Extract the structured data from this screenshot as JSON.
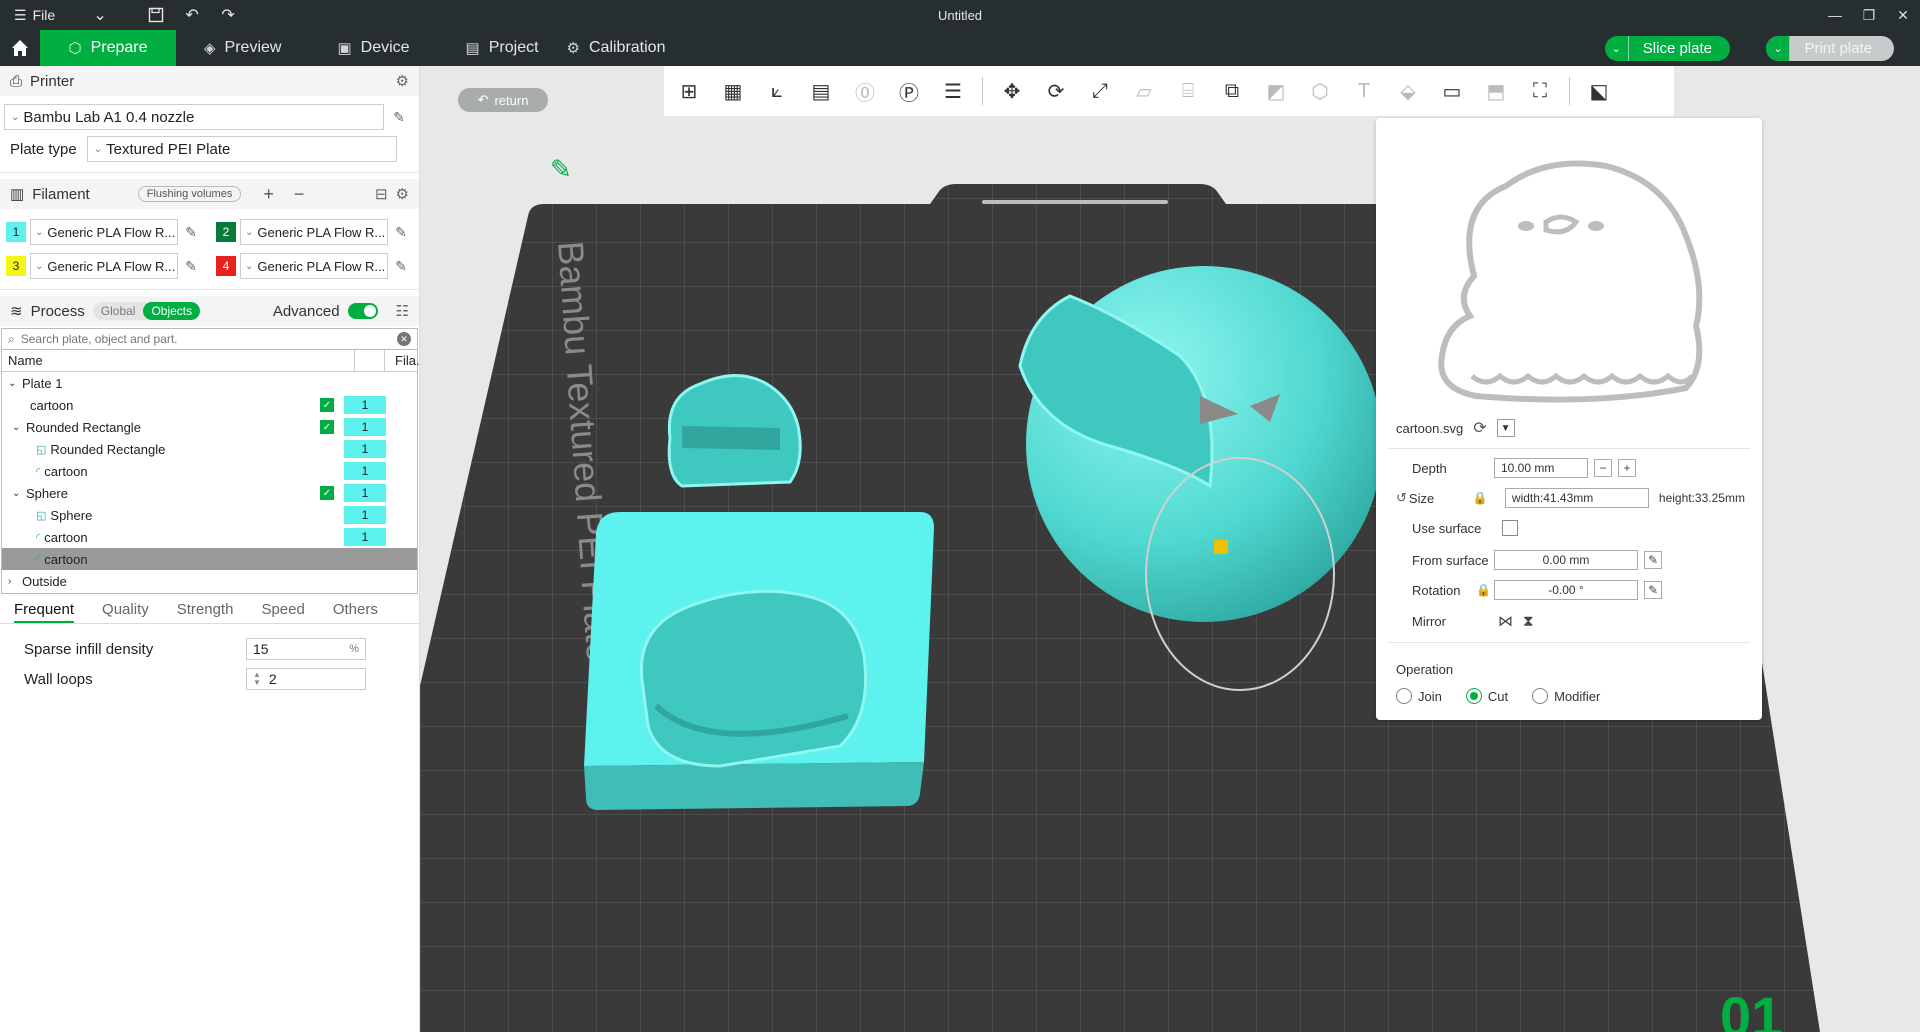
{
  "titlebar": {
    "file_label": "File",
    "window_title": "Untitled"
  },
  "tabs": {
    "prepare": "Prepare",
    "preview": "Preview",
    "device": "Device",
    "project": "Project",
    "calibration": "Calibration"
  },
  "actions": {
    "slice": "Slice plate",
    "print": "Print plate"
  },
  "printer": {
    "section": "Printer",
    "name": "Bambu Lab A1 0.4 nozzle",
    "plate_type_label": "Plate type",
    "plate_type": "Textured PEI Plate"
  },
  "filament": {
    "section": "Filament",
    "flushing": "Flushing volumes",
    "items": [
      {
        "num": "1",
        "color": "#5ef2ee",
        "name": "Generic PLA Flow R..."
      },
      {
        "num": "2",
        "color": "#0a7a3a",
        "name": "Generic PLA Flow R..."
      },
      {
        "num": "3",
        "color": "#f5f51a",
        "name": "Generic PLA Flow R..."
      },
      {
        "num": "4",
        "color": "#e8231f",
        "name": "Generic PLA Flow R..."
      }
    ]
  },
  "process": {
    "section": "Process",
    "global": "Global",
    "objects": "Objects",
    "advanced": "Advanced",
    "search_placeholder": "Search plate, object and part."
  },
  "tree": {
    "col_name": "Name",
    "col_fila": "Fila.",
    "plate": "Plate 1",
    "rows": [
      {
        "name": "cartoon",
        "fila": "1"
      },
      {
        "name": "Rounded Rectangle",
        "fila": "1"
      },
      {
        "name": "Rounded Rectangle",
        "fila": "1"
      },
      {
        "name": "cartoon",
        "fila": "1"
      },
      {
        "name": "Sphere",
        "fila": "1"
      },
      {
        "name": "Sphere",
        "fila": "1"
      },
      {
        "name": "cartoon",
        "fila": "1"
      },
      {
        "name": "cartoon",
        "fila": ""
      }
    ],
    "outside": "Outside"
  },
  "settings": {
    "tabs": [
      "Frequent",
      "Quality",
      "Strength",
      "Speed",
      "Others"
    ],
    "sparse_label": "Sparse infill density",
    "sparse_value": "15",
    "sparse_unit": "%",
    "wall_label": "Wall loops",
    "wall_value": "2"
  },
  "viewport": {
    "return_label": "return",
    "plate_text": "Bambu Textured PEI Plate",
    "plate_number": "01"
  },
  "svg_panel": {
    "filename": "cartoon.svg",
    "depth_label": "Depth",
    "depth_value": "10.00 mm",
    "size_label": "Size",
    "width_value": "width:41.43mm",
    "height_value": "height:33.25mm",
    "use_surface_label": "Use surface",
    "from_surface_label": "From surface",
    "from_surface_value": "0.00 mm",
    "rotation_label": "Rotation",
    "rotation_value": "-0.00 °",
    "mirror_label": "Mirror",
    "operation_label": "Operation",
    "op_join": "Join",
    "op_cut": "Cut",
    "op_modifier": "Modifier"
  }
}
